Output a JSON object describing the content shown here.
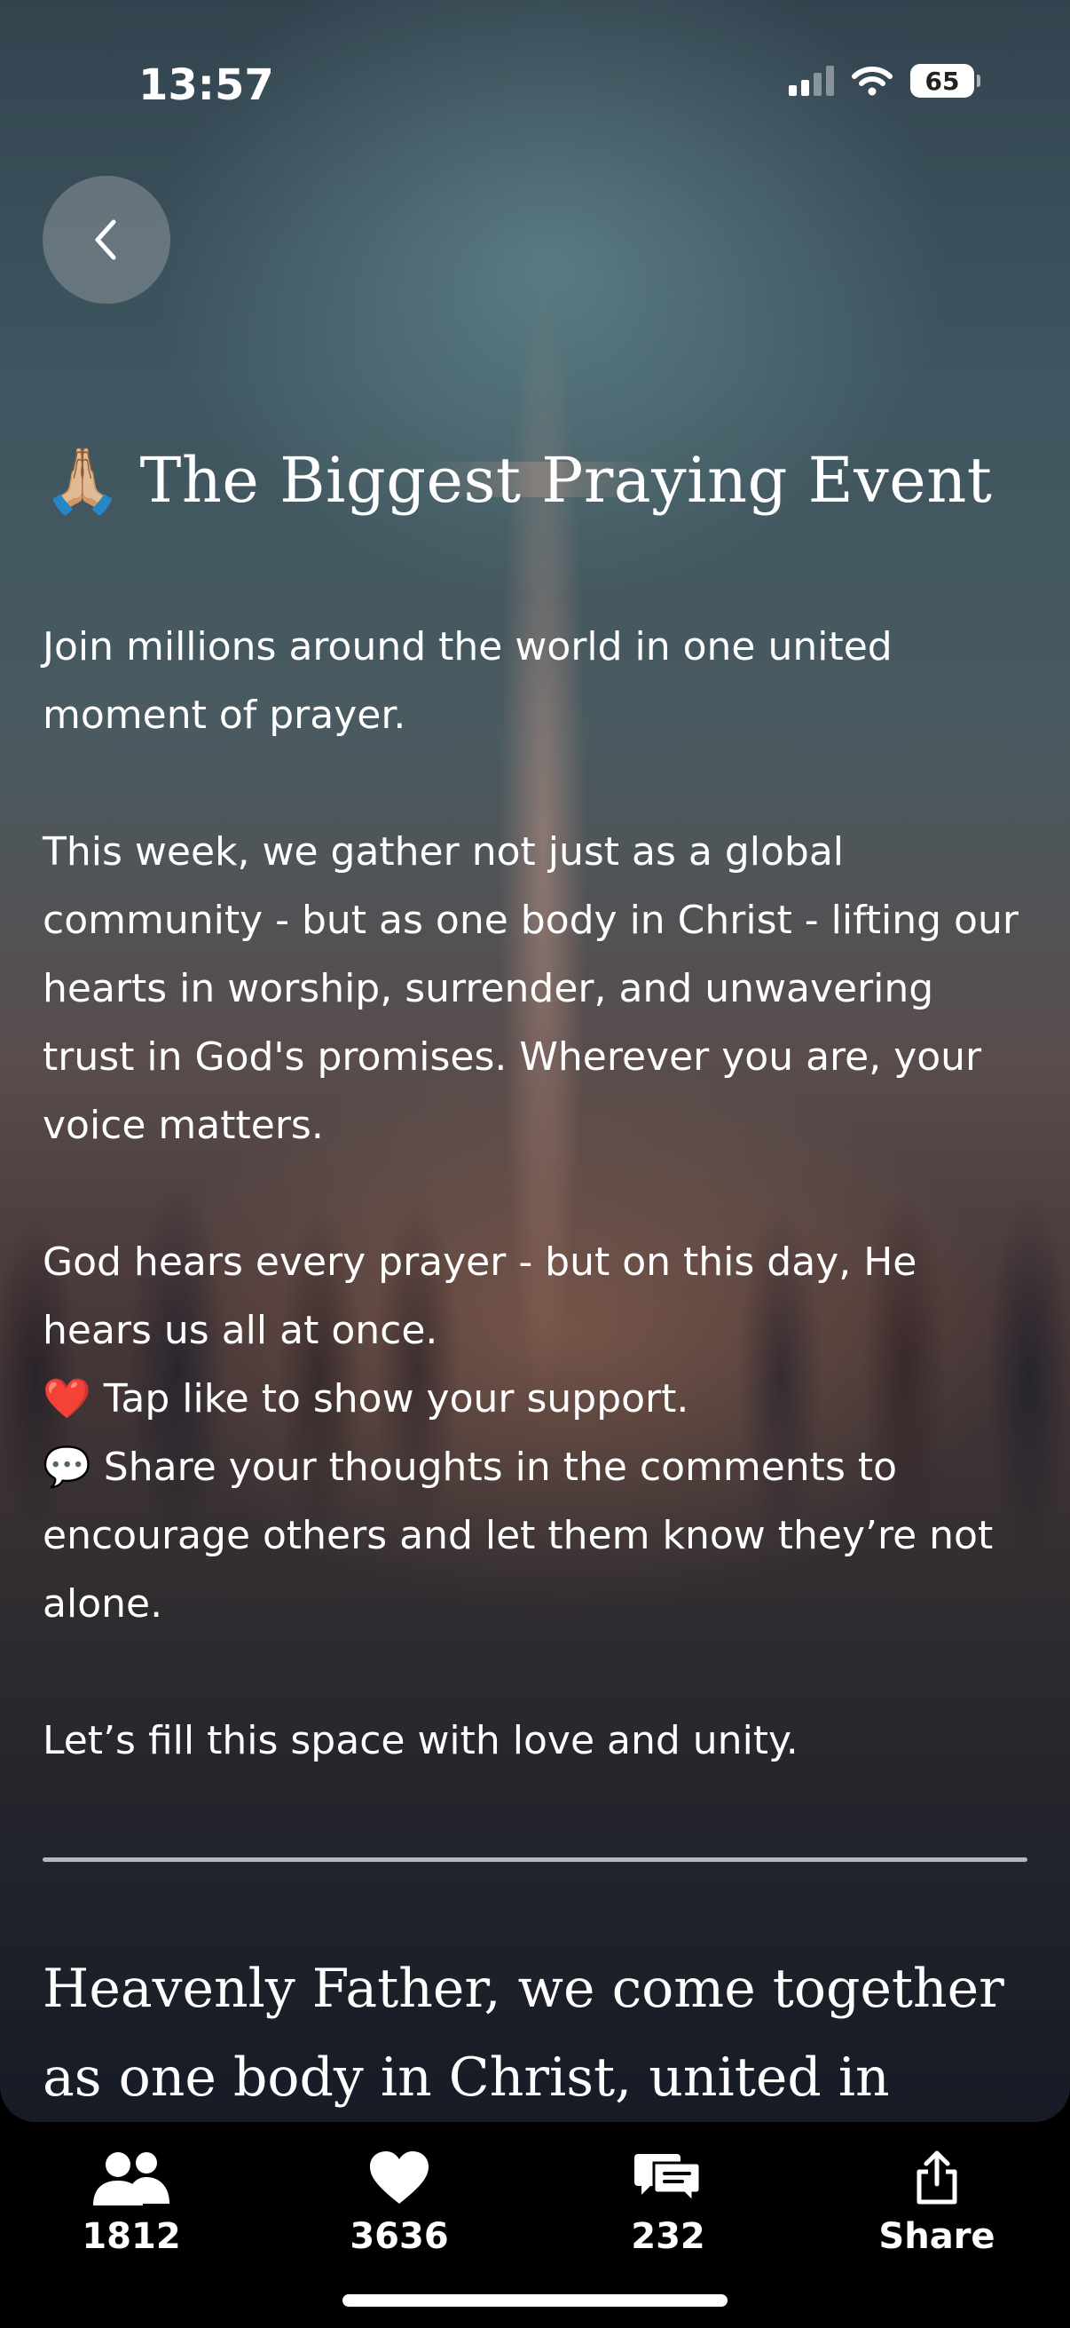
{
  "status_bar": {
    "time": "13:57",
    "battery_level": "65",
    "icons": [
      "cellular-signal-icon",
      "wifi-icon",
      "battery-icon"
    ]
  },
  "nav": {
    "back_icon": "chevron-left-icon"
  },
  "post": {
    "title_emoji": "🙏🏼",
    "title": "The Biggest Praying Event",
    "intro": "Join millions around the world in one united moment of prayer.",
    "paragraph_2": "This week, we gather not just as a global community - but as one body in Christ - lifting our hearts in worship, surrender, and unwavering trust in God's promises. Wherever you are, your voice matters.",
    "paragraph_3": "God hears every prayer - but on this day, He hears us all at once.",
    "like_emoji": "❤️",
    "like_text": "Tap like to show your support.",
    "comment_emoji": "💬",
    "comment_text": "Share your thoughts in the comments to encourage others and let them know they’re not alone.",
    "closing": "Let’s fill this space with love and unity."
  },
  "prayer": {
    "text": "Heavenly Father, we come together as one body in Christ, united in prayer and"
  },
  "tab_bar": {
    "participants": {
      "icon": "people-icon",
      "label": "1812"
    },
    "likes": {
      "icon": "heart-icon",
      "label": "3636"
    },
    "comments": {
      "icon": "comments-icon",
      "label": "232"
    },
    "share": {
      "icon": "share-icon",
      "label": "Share"
    }
  }
}
